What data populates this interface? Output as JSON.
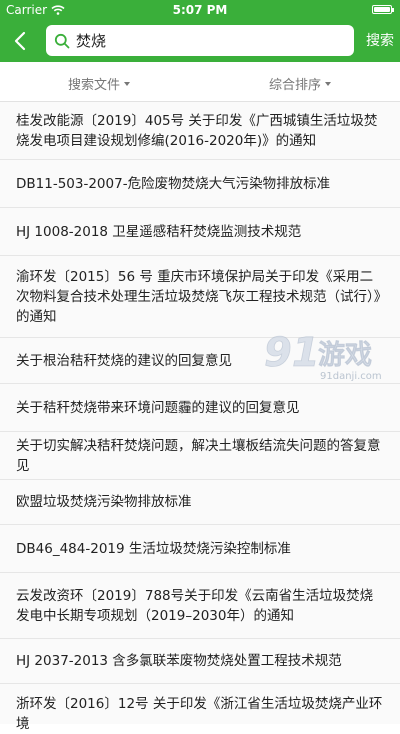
{
  "status_bar": {
    "carrier": "Carrier",
    "time": "5:07 PM"
  },
  "nav": {
    "back_icon": "chevron-left-icon",
    "search_value": "焚烧",
    "search_button": "搜索"
  },
  "filters": {
    "files_label": "搜索文件",
    "sort_label": "综合排序"
  },
  "results": [
    "桂发改能源〔2019〕405号 关于印发《广西城镇生活垃圾焚烧发电项目建设规划修编(2016-2020年)》的通知",
    "DB11-503-2007-危险废物焚烧大气污染物排放标准",
    "HJ 1008-2018 卫星遥感秸秆焚烧监测技术规范",
    "渝环发〔2015〕56 号 重庆市环境保护局关于印发《采用二次物料复合技术处理生活垃圾焚烧飞灰工程技术规范（试行）》的通知",
    "关于根治秸秆焚烧的建议的回复意见",
    "关于秸秆焚烧带来环境问题霾的建议的回复意见",
    "关于切实解决秸秆焚烧问题，解决土壤板结流失问题的答复意见",
    "欧盟垃圾焚烧污染物排放标准",
    "DB46_484-2019 生活垃圾焚烧污染控制标准",
    "云发改资环〔2019〕788号关于印发《云南省生活垃圾焚烧发电中长期专项规划（2019–2030年）的通知",
    "HJ 2037-2013 含多氯联苯废物焚烧处置工程技术规范",
    "浙环发〔2016〕12号 关于印发《浙江省生活垃圾焚烧产业环境"
  ],
  "watermark": {
    "logo_text": "91游戏",
    "url_text": "91danji.com"
  },
  "colors": {
    "brand_green": "#3aaf3a",
    "divider": "#e6e6e6",
    "muted_text": "#777777"
  }
}
